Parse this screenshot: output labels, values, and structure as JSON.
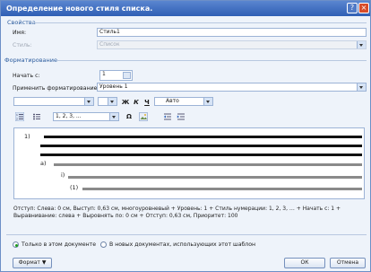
{
  "window": {
    "title": "Определение нового стиля списка.",
    "help": "?",
    "close": "×"
  },
  "properties": {
    "section": "Свойства",
    "name_label": "Имя:",
    "name_value": "Стиль1",
    "style_label": "Стиль:",
    "style_value": "Список"
  },
  "formatting": {
    "section": "Форматирование",
    "start_label": "Начать с:",
    "start_value": "1",
    "apply_label": "Применить форматирование к:",
    "apply_value": "Уровень 1",
    "bold": "Ж",
    "italic": "К",
    "underline": "Ч",
    "color_value": "Авто",
    "numbering_value": "1, 2, 3, ...",
    "omega": "Ω"
  },
  "preview": {
    "level1": "1)",
    "level2": "а)",
    "level3": "i)",
    "level4": "(1)"
  },
  "description": "Отступ: Слева: 0 см, Выступ: 0,63 см, многоуровневый + Уровень: 1 + Стиль нумерации: 1, 2, 3, … + Начать с: 1 + Выравнивание: слева + Выровнять по: 0 см + Отступ: 0,63 см, Приоритет: 100",
  "options": {
    "only_doc": "Только в этом документе",
    "new_docs": "В новых документах, использующих этот шаблон"
  },
  "footer": {
    "format": "Формат ▼",
    "ok": "ОК",
    "cancel": "Отмена"
  }
}
